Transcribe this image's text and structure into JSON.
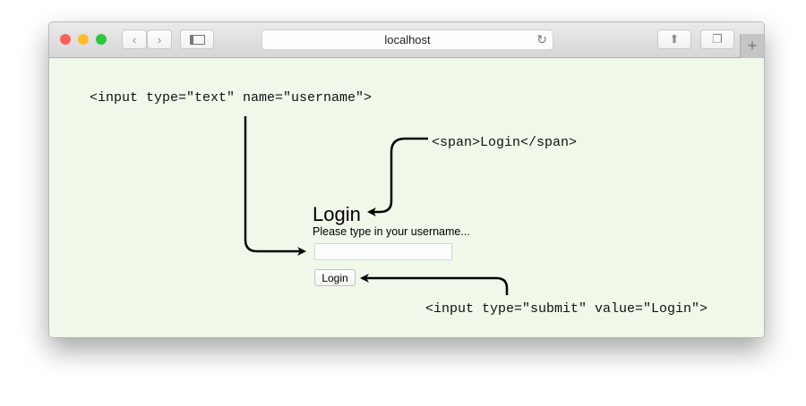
{
  "browser": {
    "url": "localhost",
    "traffic_colors": {
      "close": "#fe5f57",
      "minimize": "#febc2e",
      "zoom": "#28c840"
    }
  },
  "page": {
    "title": "Login",
    "hint": "Please type in your username...",
    "username_value": "",
    "button_label": "Login",
    "background": "#f0f8ea"
  },
  "annotations": {
    "input_text": "<input type=\"text\" name=\"username\">",
    "span": "<span>Login</span>",
    "input_submit": "<input type=\"submit\" value=\"Login\">"
  }
}
